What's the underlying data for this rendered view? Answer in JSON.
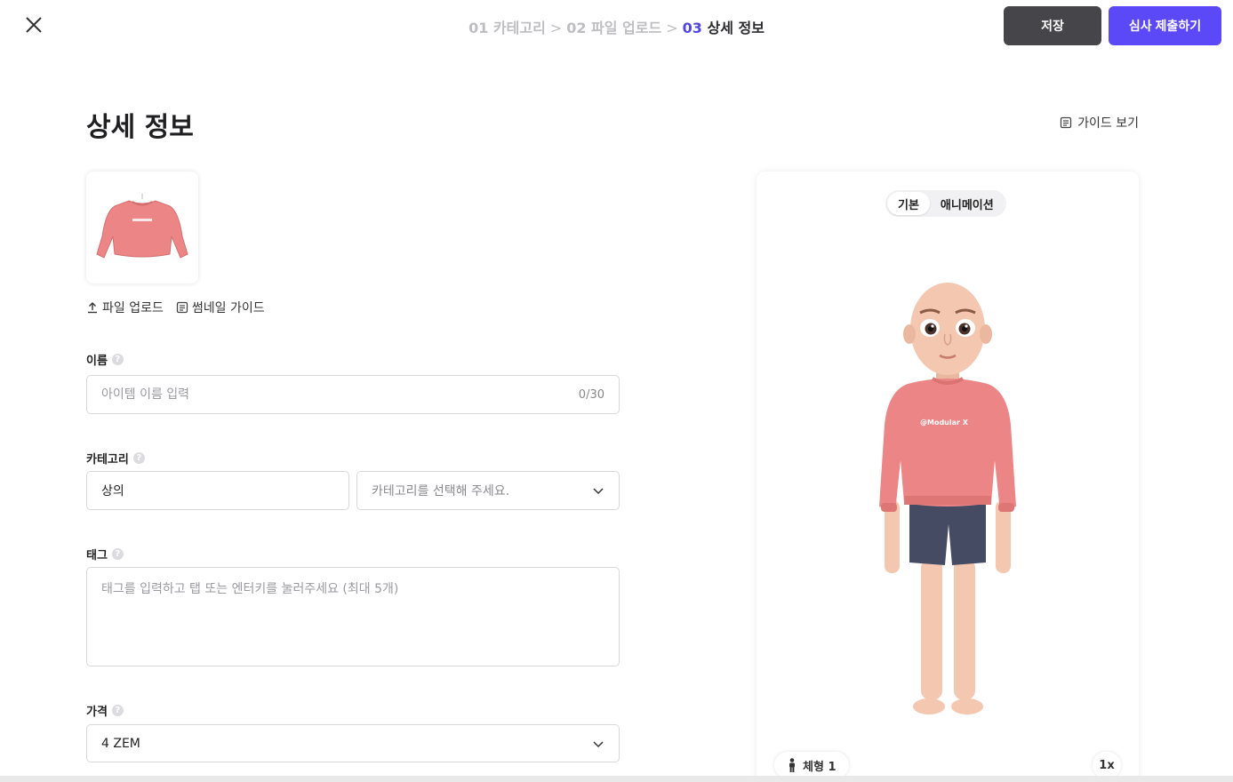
{
  "header": {
    "breadcrumb": [
      {
        "num": "01",
        "text": "카테고리"
      },
      {
        "num": "02",
        "text": "파일 업로드"
      },
      {
        "num": "03",
        "text": "상세 정보"
      }
    ],
    "save_label": "저장",
    "submit_label": "심사 제출하기"
  },
  "page": {
    "title": "상세 정보",
    "guide_label": "가이드 보기"
  },
  "thumbnail": {
    "upload_label": "파일 업로드",
    "guide_label": "썸네일 가이드"
  },
  "form": {
    "name": {
      "label": "이름",
      "placeholder": "아이템 이름 입력",
      "counter": "0/30"
    },
    "category": {
      "label": "카테고리",
      "primary_value": "상의",
      "secondary_placeholder": "카테고리를 선택해 주세요."
    },
    "tag": {
      "label": "태그",
      "placeholder": "태그를 입력하고 탭 또는 엔터키를 눌러주세요 (최대 5개)"
    },
    "price": {
      "label": "가격",
      "value": "4 ZEM"
    }
  },
  "preview": {
    "tabs": [
      "기본",
      "애니메이션"
    ],
    "active_tab": 0,
    "body_type_label": "체형 1",
    "speed_label": "1x",
    "shirt_text": "@Modular X"
  },
  "colors": {
    "accent": "#5b48f6",
    "breadcrumb_active": "#5146e6",
    "shirt": "#ec8585",
    "shorts": "#454b63",
    "skin": "#f3c7b0"
  },
  "icons": {
    "close": "close-icon",
    "chevron": "chevron-down-icon",
    "doc": "document-icon",
    "upload": "upload-icon",
    "person": "person-icon",
    "help": "help-icon"
  }
}
